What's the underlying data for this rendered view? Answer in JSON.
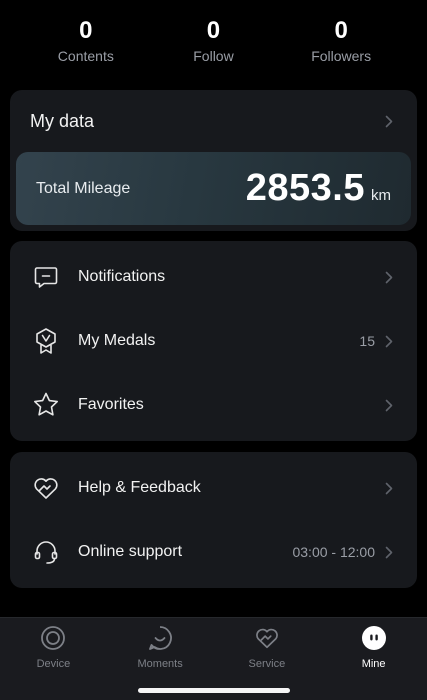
{
  "stats": [
    {
      "value": "0",
      "label": "Contents"
    },
    {
      "value": "0",
      "label": "Follow"
    },
    {
      "value": "0",
      "label": "Followers"
    }
  ],
  "my_data": {
    "title": "My data",
    "mileage_label": "Total Mileage",
    "mileage_value": "2853.5",
    "mileage_unit": "km"
  },
  "menu1": {
    "notifications": {
      "label": "Notifications",
      "icon": "message-icon"
    },
    "medals": {
      "label": "My Medals",
      "count": "15",
      "icon": "medal-icon"
    },
    "favorites": {
      "label": "Favorites",
      "icon": "star-icon"
    }
  },
  "menu2": {
    "help": {
      "label": "Help & Feedback",
      "icon": "heart-handshake-icon"
    },
    "support": {
      "label": "Online support",
      "hours": "03:00 - 12:00",
      "icon": "headset-icon"
    }
  },
  "tabs": {
    "device": "Device",
    "moments": "Moments",
    "service": "Service",
    "mine": "Mine",
    "active": "mine"
  },
  "colors": {
    "background": "#000000",
    "card": "#17191d",
    "muted_text": "#9a9ea6",
    "mileage_gradient_start": "#33434d",
    "tab_inactive": "#7d8087"
  }
}
